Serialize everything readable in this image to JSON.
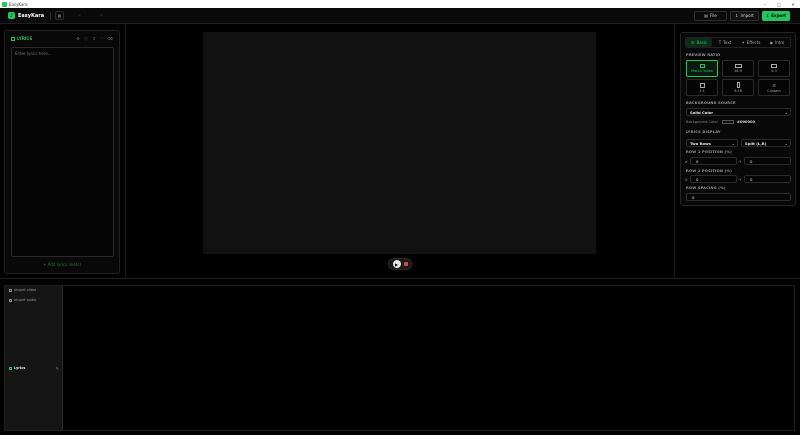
{
  "window": {
    "title": "EasyKara"
  },
  "toolbar": {
    "brand": "EasyKara",
    "file_label": "File",
    "import_label": "Import",
    "export_label": "Export"
  },
  "lyrics": {
    "title": "LYRICS",
    "placeholder": "Enter lyrics here...",
    "footer": "+ Add lyrics line(s)"
  },
  "settings": {
    "tabs": [
      {
        "label": "Basic"
      },
      {
        "label": "Text"
      },
      {
        "label": "Effects"
      },
      {
        "label": "Intro"
      }
    ],
    "preview_ratio_label": "PREVIEW RATIO",
    "ratios": [
      {
        "label": "Match Video",
        "active": true
      },
      {
        "label": "16:9"
      },
      {
        "label": "4:3"
      },
      {
        "label": "1:1"
      },
      {
        "label": "9:16"
      },
      {
        "label": "Custom"
      }
    ],
    "background_source_label": "BACKGROUND SOURCE",
    "background_source_value": "Solid Color",
    "background_color_label": "Background Color",
    "background_color_value": "#000000",
    "lyrics_display_label": "LYRICS DISPLAY",
    "rows_value": "Two Rows",
    "split_value": "Split (L,R)",
    "row1_label": "ROW 1 POSITION (%)",
    "row1_x": "0",
    "row1_y": "0",
    "row2_label": "ROW 2 POSITION (%)",
    "row2_x": "0",
    "row2_y": "0",
    "row_spacing_label": "ROW SPACING (%)",
    "row_spacing_value": "0",
    "axis_x": "X",
    "axis_y": "Y"
  },
  "timeline": {
    "tracks": [
      {
        "label": "Import video"
      },
      {
        "label": "Import audio"
      },
      {
        "label": "Lyrics"
      }
    ]
  },
  "colors": {
    "accent": "#22c55e",
    "background": "#000000",
    "panel": "#080808"
  }
}
